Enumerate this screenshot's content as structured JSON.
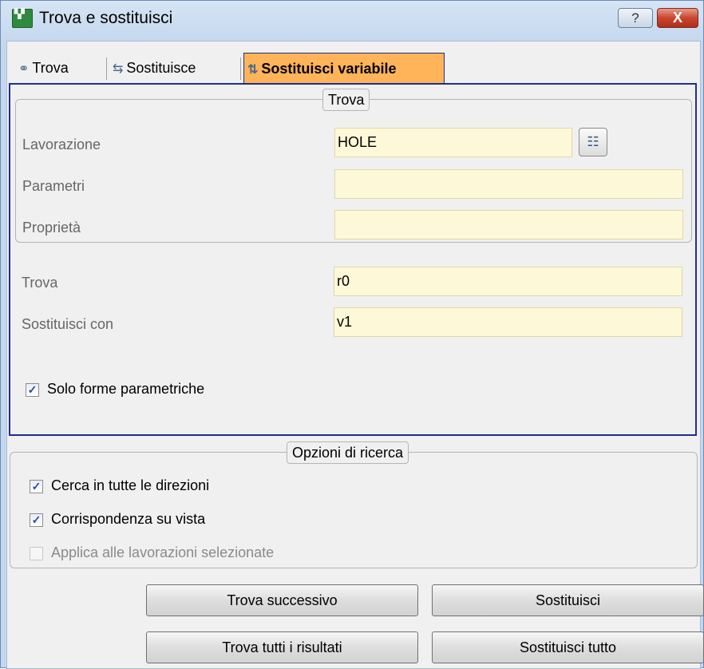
{
  "window": {
    "title": "Trova e sostituisci",
    "icon": "app-icon",
    "help_label": "?",
    "close_label": "X"
  },
  "tabs": [
    {
      "label": "Trova",
      "icon": "binoculars-icon",
      "active": false
    },
    {
      "label": "Sostituisce",
      "icon": "replace-icon",
      "active": false
    },
    {
      "label": "Sostituisci variabile",
      "icon": "replace-variable-icon",
      "active": true
    }
  ],
  "find_group": {
    "legend": "Trova",
    "lavorazione_label": "Lavorazione",
    "lavorazione_value": "HOLE",
    "parametri_label": "Parametri",
    "parametri_value": "",
    "proprieta_label": "Proprietà",
    "proprieta_value": ""
  },
  "replace": {
    "trova_label": "Trova",
    "trova_value": "r0",
    "sostituisci_label": "Sostituisci con",
    "sostituisci_value": "v1"
  },
  "solo_forme": {
    "label": "Solo forme parametriche",
    "checked": true
  },
  "options": {
    "legend": "Opzioni di ricerca",
    "items": [
      {
        "label": "Cerca in tutte le direzioni",
        "checked": true,
        "enabled": true
      },
      {
        "label": "Corrispondenza su vista",
        "checked": true,
        "enabled": true
      },
      {
        "label": "Applica alle lavorazioni selezionate",
        "checked": false,
        "enabled": false
      }
    ]
  },
  "buttons": {
    "find_next": "Trova successivo",
    "replace": "Sostituisci",
    "find_all": "Trova tutti i risultati",
    "replace_all": "Sostituisci tutto"
  },
  "colors": {
    "active_tab": "#ffb45a",
    "panel_border": "#1e2f8f",
    "field_bg": "#fdf8d8"
  }
}
